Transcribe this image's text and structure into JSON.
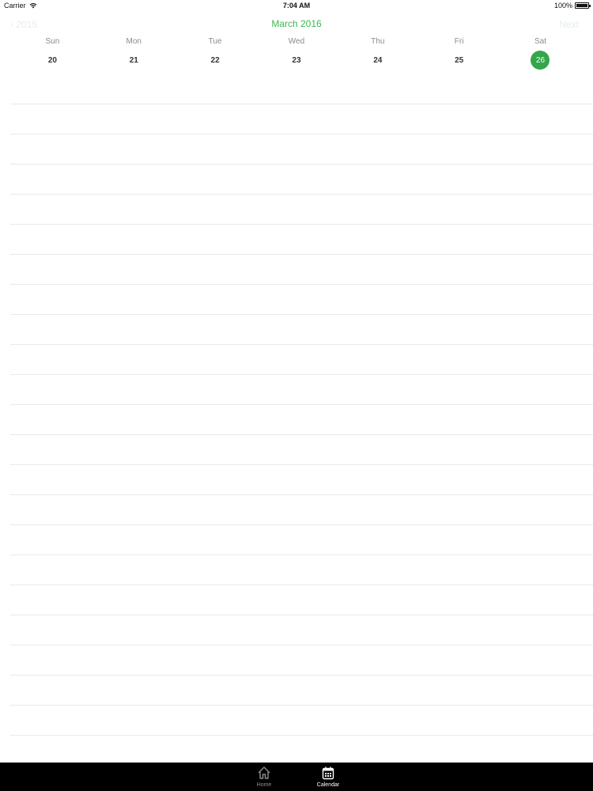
{
  "status_bar": {
    "carrier": "Carrier",
    "time": "7:04 AM",
    "battery_text": "100%",
    "battery_level": 1.0
  },
  "calendar": {
    "title": "March 2016",
    "prev_label": "‹ 2015",
    "next_label": "Next",
    "accent_color": "#33a64a",
    "days": [
      {
        "name": "Sun",
        "date": "20",
        "selected": false
      },
      {
        "name": "Mon",
        "date": "21",
        "selected": false
      },
      {
        "name": "Tue",
        "date": "22",
        "selected": false
      },
      {
        "name": "Wed",
        "date": "23",
        "selected": false
      },
      {
        "name": "Thu",
        "date": "24",
        "selected": false
      },
      {
        "name": "Fri",
        "date": "25",
        "selected": false
      },
      {
        "name": "Sat",
        "date": "26",
        "selected": true
      }
    ]
  },
  "tab_bar": {
    "home_label": "Home",
    "home_icon": "home-icon",
    "calendar_label": "Calendar",
    "calendar_icon": "calendar-icon",
    "active_tab": "Calendar"
  }
}
